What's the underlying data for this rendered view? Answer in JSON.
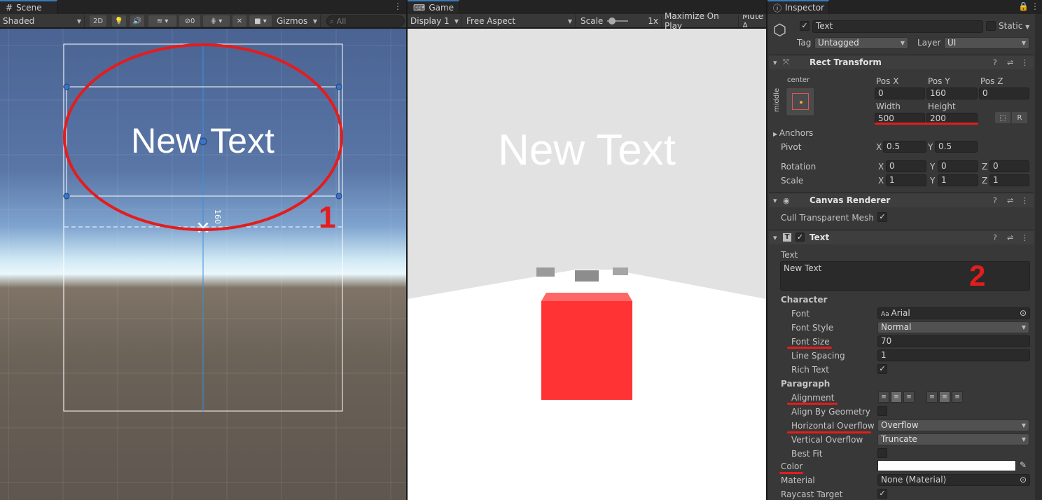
{
  "colors": {
    "accent": "#3a79bb",
    "annotation_red": "#e31d1d",
    "cube_red": "#ff3333"
  },
  "scene": {
    "tab": "Scene",
    "shading": "Shaded",
    "btn_2d": "2D",
    "hidden_count": "0",
    "gizmos": "Gizmos",
    "search_placeholder": "All",
    "canvas_text": "New Text",
    "measure": "160",
    "annotation": "1"
  },
  "game": {
    "tab": "Game",
    "display": "Display 1",
    "aspect": "Free Aspect",
    "scale_label": "Scale",
    "scale_value": "1x",
    "maximize": "Maximize On Play",
    "mute": "Mute A",
    "game_text": "New Text"
  },
  "inspector": {
    "tab": "Inspector",
    "object_name": "Text",
    "static": "Static",
    "tag_label": "Tag",
    "tag_value": "Untagged",
    "layer_label": "Layer",
    "layer_value": "UI",
    "rect": {
      "title": "Rect Transform",
      "anchor_h": "center",
      "anchor_v": "middle",
      "pos_x_label": "Pos X",
      "pos_y_label": "Pos Y",
      "pos_z_label": "Pos Z",
      "pos_x": "0",
      "pos_y": "160",
      "pos_z": "0",
      "width_label": "Width",
      "height_label": "Height",
      "width": "500",
      "height": "200",
      "r_btn": "R",
      "anchors": "Anchors",
      "pivot": "Pivot",
      "pivot_x": "0.5",
      "pivot_y": "0.5",
      "rotation": "Rotation",
      "rot_x": "0",
      "rot_y": "0",
      "rot_z": "0",
      "scale": "Scale",
      "scale_x": "1",
      "scale_y": "1",
      "scale_z": "1",
      "x": "X",
      "y": "Y",
      "z": "Z"
    },
    "canvas_renderer": {
      "title": "Canvas Renderer",
      "cull": "Cull Transparent Mesh"
    },
    "text": {
      "title": "Text",
      "text_label": "Text",
      "text_value": "New Text",
      "annotation": "2",
      "character": "Character",
      "font_label": "Font",
      "font_value": "Arial",
      "font_style_label": "Font Style",
      "font_style_value": "Normal",
      "font_size_label": "Font Size",
      "font_size_value": "70",
      "line_spacing_label": "Line Spacing",
      "line_spacing_value": "1",
      "rich_text_label": "Rich Text",
      "paragraph": "Paragraph",
      "alignment_label": "Alignment",
      "align_geometry_label": "Align By Geometry",
      "h_overflow_label": "Horizontal Overflow",
      "h_overflow_value": "Overflow",
      "v_overflow_label": "Vertical Overflow",
      "v_overflow_value": "Truncate",
      "best_fit_label": "Best Fit",
      "color_label": "Color",
      "material_label": "Material",
      "material_value": "None (Material)",
      "raycast_label": "Raycast Target"
    }
  }
}
